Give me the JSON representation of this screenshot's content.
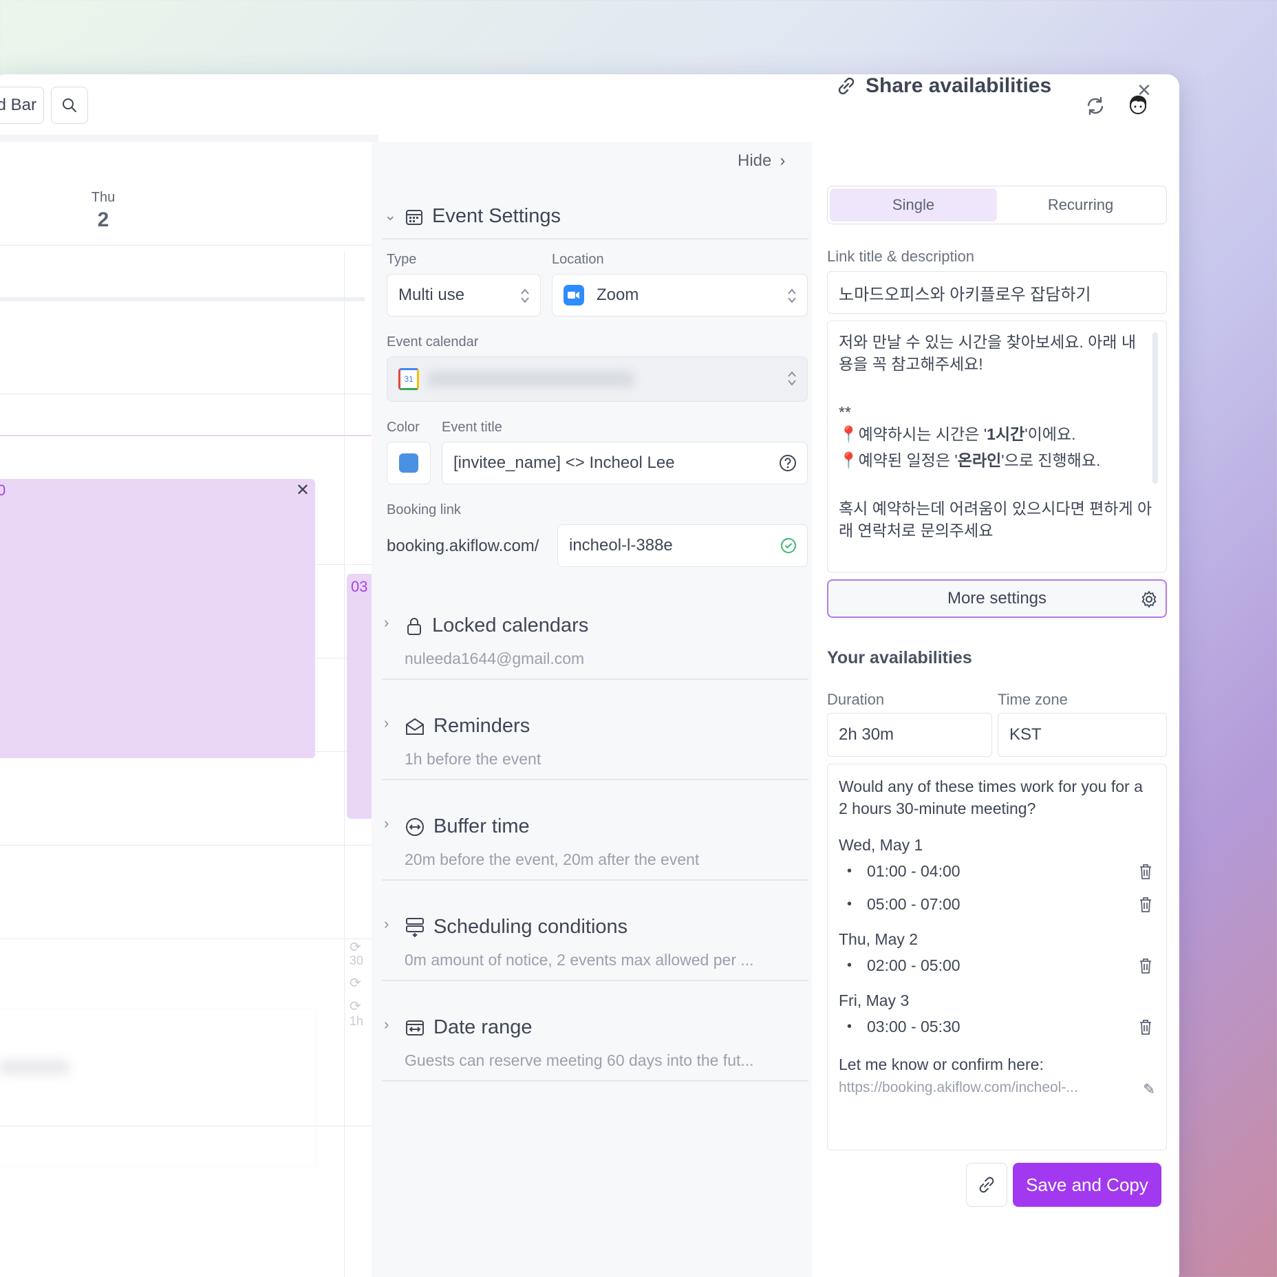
{
  "topbar": {
    "command_bar_label": "d Bar"
  },
  "calendar": {
    "day_name": "Thu",
    "day_number": "2",
    "event_big_time": "0",
    "event_small_time": "03",
    "small_labels": [
      "30",
      "1h"
    ]
  },
  "event_settings": {
    "hide_label": "Hide",
    "title": "Event Settings",
    "type_label": "Type",
    "type_value": "Multi use",
    "location_label": "Location",
    "location_value": "Zoom",
    "calendar_label": "Event calendar",
    "color_label": "Color",
    "color_value": "#4a90e2",
    "event_title_label": "Event title",
    "event_title_value": "[invitee_name] <> Incheol Lee",
    "booking_label": "Booking link",
    "booking_prefix": "booking.akiflow.com/",
    "booking_slug": "incheol-l-388e",
    "sections": [
      {
        "title": "Locked calendars",
        "sub": "nuleeda1644@gmail.com",
        "icon": "lock-icon"
      },
      {
        "title": "Reminders",
        "sub": "1h before the event",
        "icon": "envelope-icon"
      },
      {
        "title": "Buffer time",
        "sub": "20m before the event, 20m after the event",
        "icon": "buffer-icon"
      },
      {
        "title": "Scheduling conditions",
        "sub": "0m amount of notice, 2 events max allowed per ...",
        "icon": "conditions-icon"
      },
      {
        "title": "Date range",
        "sub": "Guests can reserve meeting 60 days into the fut...",
        "icon": "date-range-icon"
      }
    ]
  },
  "share": {
    "title": "Share availabilities",
    "tabs": {
      "single": "Single",
      "recurring": "Recurring"
    },
    "link_label": "Link title & description",
    "link_title": "노마드오피스와 아키플로우 잡담하기",
    "desc": {
      "line1": "저와 만날 수 있는 시간을 찾아보세요. 아래 내용을 꼭 참고해주세요!",
      "line2": "**",
      "line3_a": "📍예약하시는 시간은 '",
      "line3_b": "1시간",
      "line3_c": "'이에요.",
      "line4_a": "📍예약된 일정은 '",
      "line4_b": "온라인",
      "line4_c": "'으로 진행해요.",
      "line5": "혹시 예약하는데 어려움이 있으시다면 편하게 아래 연락처로 문의주세요"
    },
    "more_settings": "More settings",
    "avail_title": "Your availabilities",
    "duration_label": "Duration",
    "duration_value": "2h 30m",
    "timezone_label": "Time zone",
    "timezone_value": "KST",
    "question": "Would any of these times work for you for a 2 hours 30-minute meeting?",
    "days": [
      {
        "day": "Wed, May 1",
        "slots": [
          "01:00 - 04:00",
          "05:00 - 07:00"
        ]
      },
      {
        "day": "Thu, May 2",
        "slots": [
          "02:00 - 05:00"
        ]
      },
      {
        "day": "Fri, May 3",
        "slots": [
          "03:00 - 05:30"
        ]
      }
    ],
    "confirm_label": "Let me know or confirm here:",
    "confirm_link": "https://booking.akiflow.com/incheol-...",
    "save_label": "Save and Copy"
  }
}
